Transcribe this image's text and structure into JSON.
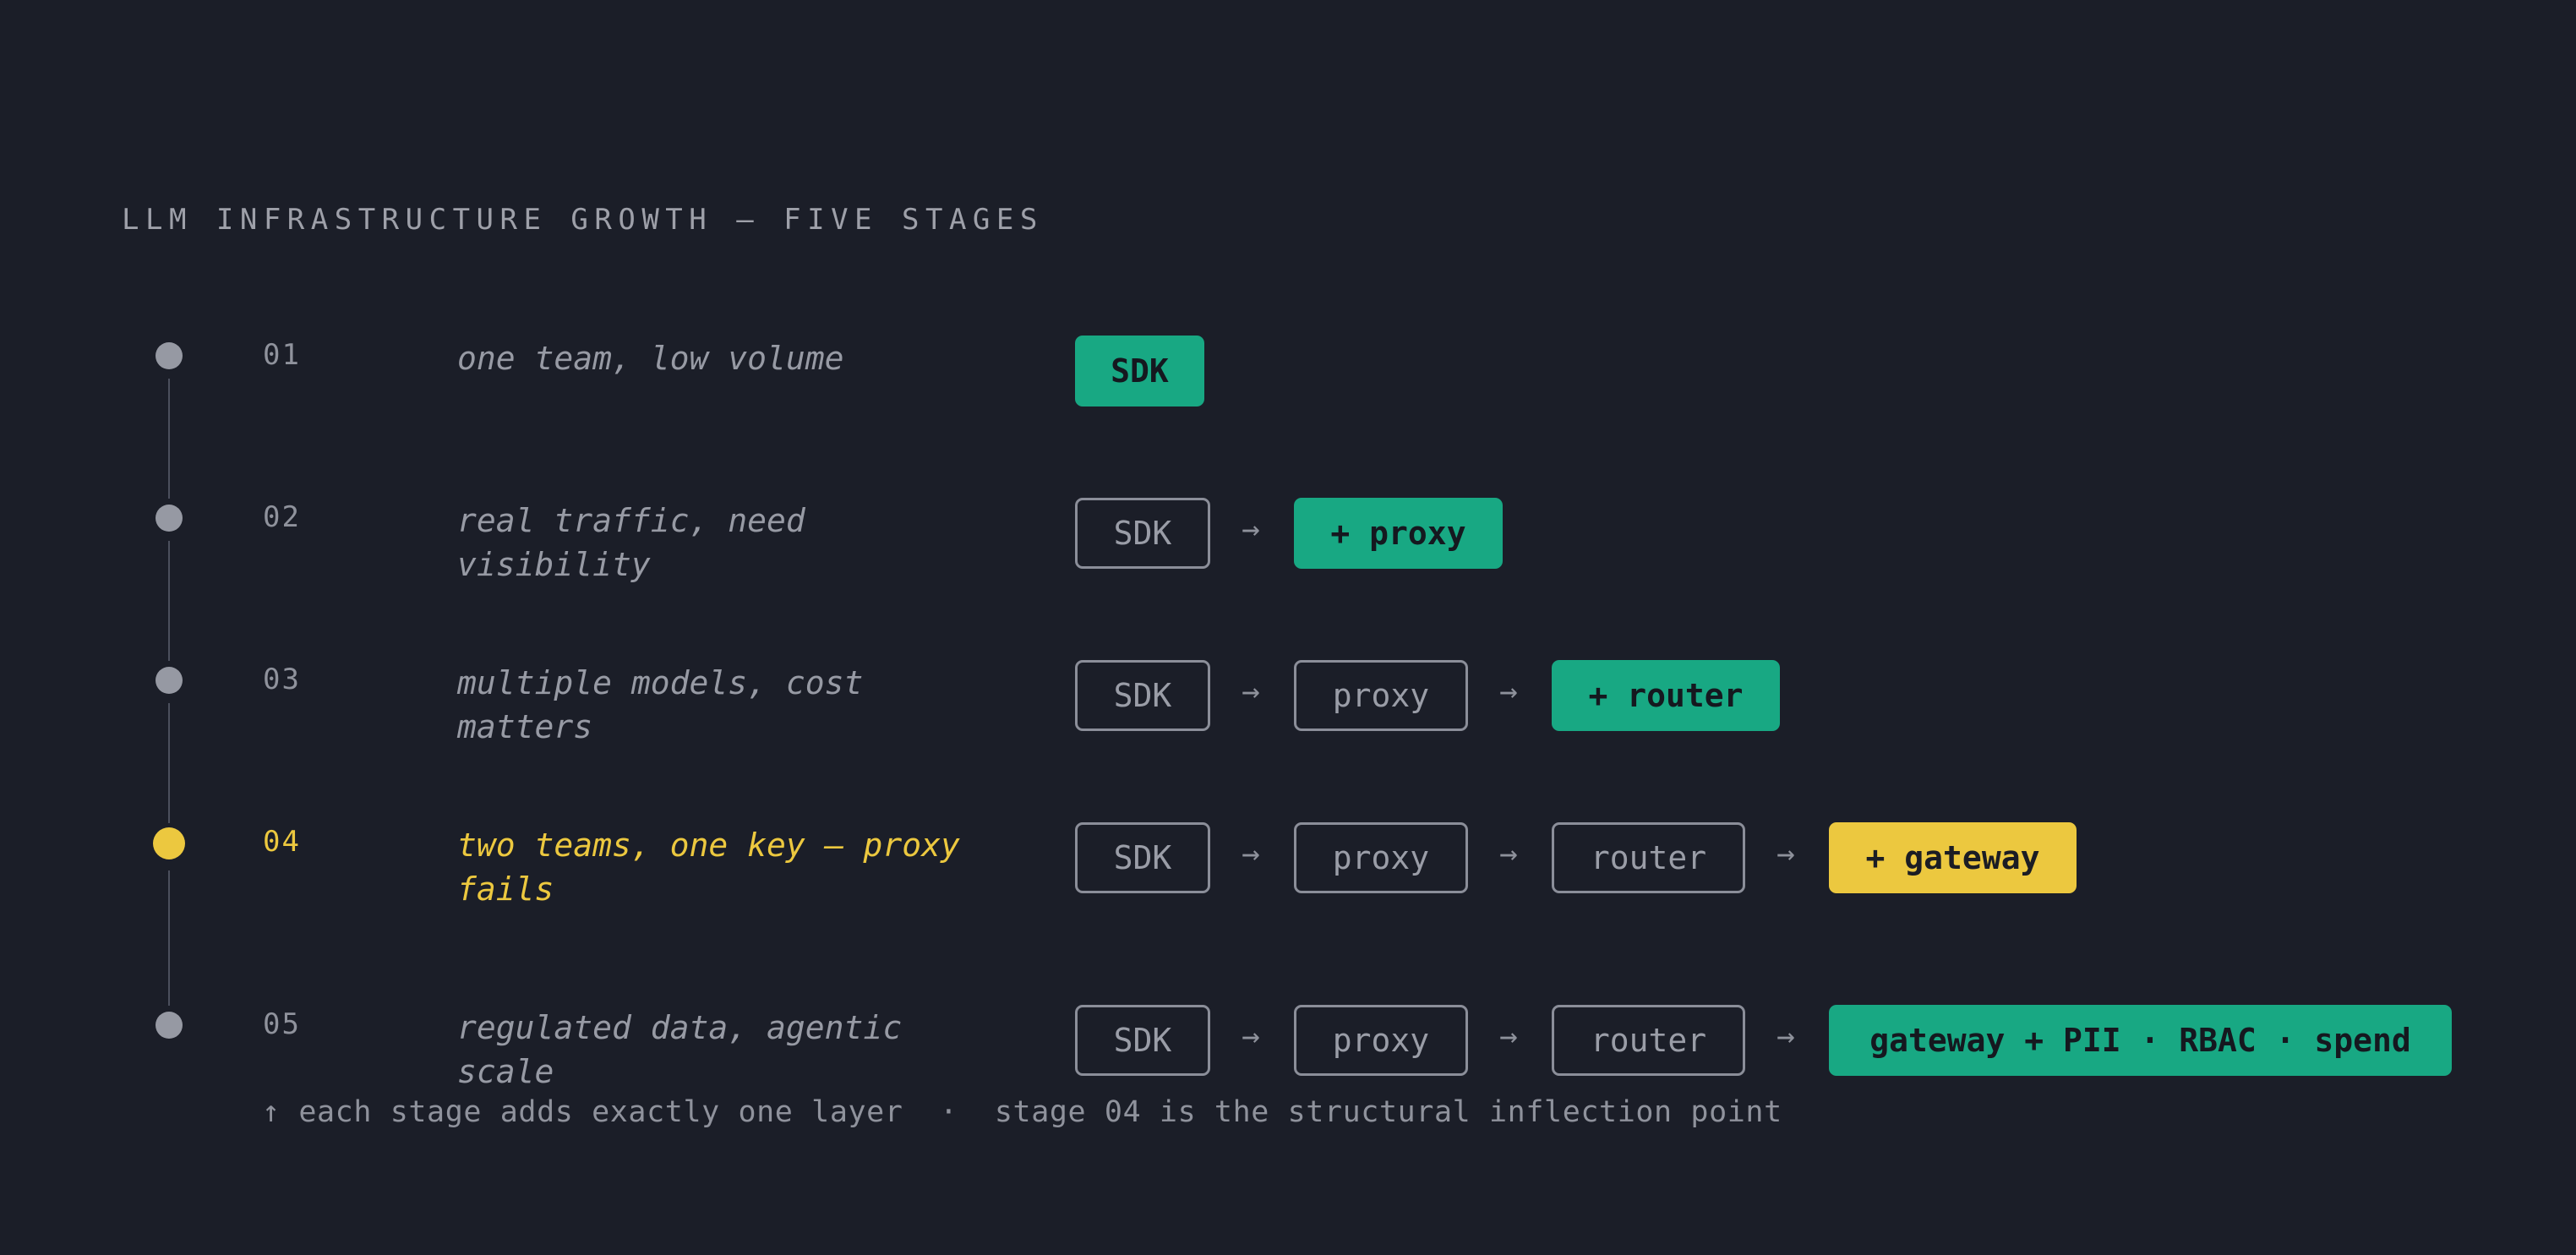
{
  "title": "LLM INFRASTRUCTURE GROWTH — FIVE STAGES",
  "colors": {
    "background": "#1b1e28",
    "accent_green": "#18a883",
    "accent_yellow": "#ecc83f",
    "muted": "#9699a3"
  },
  "stages": [
    {
      "number": "01",
      "description": "one team, low volume",
      "highlight": false,
      "components": [
        "SDK"
      ]
    },
    {
      "number": "02",
      "description": "real traffic, need visibility",
      "highlight": false,
      "components": [
        "SDK",
        "+ proxy"
      ]
    },
    {
      "number": "03",
      "description": "multiple models, cost matters",
      "highlight": false,
      "components": [
        "SDK",
        "proxy",
        "+ router"
      ]
    },
    {
      "number": "04",
      "description": "two teams, one key — proxy fails",
      "highlight": true,
      "components": [
        "SDK",
        "proxy",
        "router",
        "+ gateway"
      ]
    },
    {
      "number": "05",
      "description": "regulated data, agentic scale",
      "highlight": false,
      "components": [
        "SDK",
        "proxy",
        "router",
        "gateway + PII · RBAC · spend"
      ]
    }
  ],
  "arrow_glyph": "→",
  "footnote": "↑ each stage adds exactly one layer  ·  stage 04 is the structural inflection point"
}
